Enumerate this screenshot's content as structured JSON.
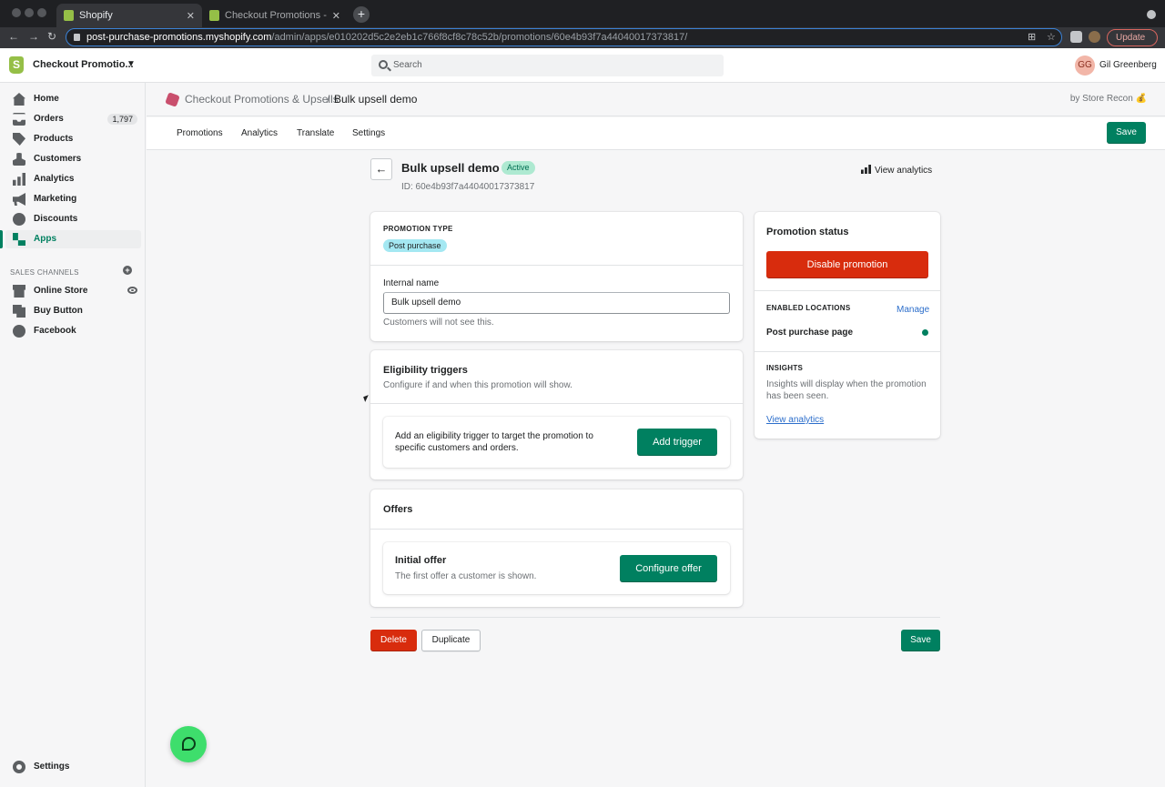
{
  "browser": {
    "tabs": [
      {
        "title": "Shopify",
        "close": "✕"
      },
      {
        "title": "Checkout Promotions - One Cl",
        "close": "✕"
      }
    ],
    "new_tab": "+",
    "url_host": "post-purchase-promotions.myshopify.com",
    "url_path": "/admin/apps/e010202d5c2e2eb1c766f8cf8c78c52b/promotions/60e4b93f7a44040017373817/",
    "update_label": "Update"
  },
  "topbar": {
    "store_name": "Checkout Promotio...",
    "search_placeholder": "Search",
    "user_initials": "GG",
    "user_name": "Gil Greenberg"
  },
  "sidebar": {
    "items": [
      {
        "label": "Home",
        "icon": "home-icon"
      },
      {
        "label": "Orders",
        "icon": "orders-icon",
        "badge": "1,797"
      },
      {
        "label": "Products",
        "icon": "tag-icon"
      },
      {
        "label": "Customers",
        "icon": "person-icon"
      },
      {
        "label": "Analytics",
        "icon": "bar-chart-icon"
      },
      {
        "label": "Marketing",
        "icon": "megaphone-icon"
      },
      {
        "label": "Discounts",
        "icon": "discount-icon"
      },
      {
        "label": "Apps",
        "icon": "apps-icon",
        "active": true
      }
    ],
    "sales_channels_label": "SALES CHANNELS",
    "channels": [
      {
        "label": "Online Store",
        "icon": "store-icon"
      },
      {
        "label": "Buy Button",
        "icon": "buy-button-icon"
      },
      {
        "label": "Facebook",
        "icon": "facebook-icon"
      }
    ],
    "settings_label": "Settings"
  },
  "app_header": {
    "app_name": "Checkout Promotions & Upsells",
    "separator": "/",
    "page_name": "Bulk upsell demo",
    "by_label": "by Store Recon 💰"
  },
  "app_tabs": [
    "Promotions",
    "Analytics",
    "Translate",
    "Settings"
  ],
  "save_label": "Save",
  "page": {
    "title": "Bulk upsell demo",
    "status": "Active",
    "id_text": "ID: 60e4b93f7a44040017373817",
    "view_analytics": "View analytics"
  },
  "promotion_card": {
    "type_label": "PROMOTION TYPE",
    "type_value": "Post purchase",
    "internal_name_label": "Internal name",
    "internal_name_value": "Bulk upsell demo",
    "internal_name_help": "Customers will not see this."
  },
  "eligibility_card": {
    "title": "Eligibility triggers",
    "subtitle": "Configure if and when this promotion will show.",
    "body": "Add an eligibility trigger to target the promotion to specific customers and orders.",
    "button": "Add trigger"
  },
  "offers_card": {
    "title": "Offers",
    "offer_title": "Initial offer",
    "offer_subtitle": "The first offer a customer is shown.",
    "button": "Configure offer"
  },
  "status_card": {
    "title": "Promotion status",
    "disable_button": "Disable promotion",
    "locations_label": "ENABLED LOCATIONS",
    "manage_link": "Manage",
    "location_name": "Post purchase page",
    "insights_label": "INSIGHTS",
    "insights_text": "Insights will display when the promotion has been seen.",
    "insights_link": "View analytics"
  },
  "footer_actions": {
    "delete": "Delete",
    "duplicate": "Duplicate",
    "save": "Save"
  },
  "colors": {
    "primary": "#008060",
    "critical": "#d82c0d",
    "active_badge": "#aee9d1",
    "type_pill": "#a4e8f2"
  }
}
